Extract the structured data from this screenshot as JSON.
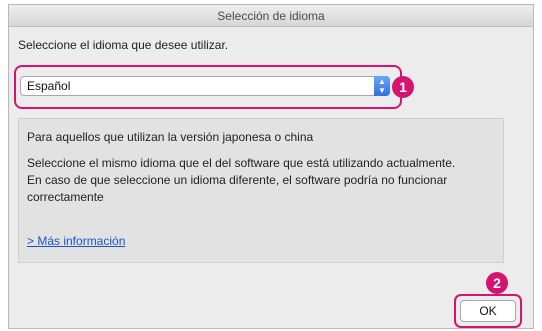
{
  "window": {
    "title": "Selección de idioma"
  },
  "prompt": "Seleccione el idioma que desee utilizar.",
  "language_select": {
    "selected": "Español"
  },
  "callouts": {
    "one": "1",
    "two": "2"
  },
  "info": {
    "heading": "Para aquellos que utilizan la versión japonesa o china",
    "line1": "Seleccione el mismo idioma que el del software que está utilizando actualmente.",
    "line2": "En caso de que seleccione un idioma diferente, el software podría no funcionar",
    "line3": "correctamente",
    "link": "> Más información"
  },
  "buttons": {
    "ok": "OK"
  },
  "colors": {
    "callout": "#d4146f",
    "link": "#1b52c9"
  },
  "icons": {
    "select_arrows": "up-down-chevron-icon"
  }
}
